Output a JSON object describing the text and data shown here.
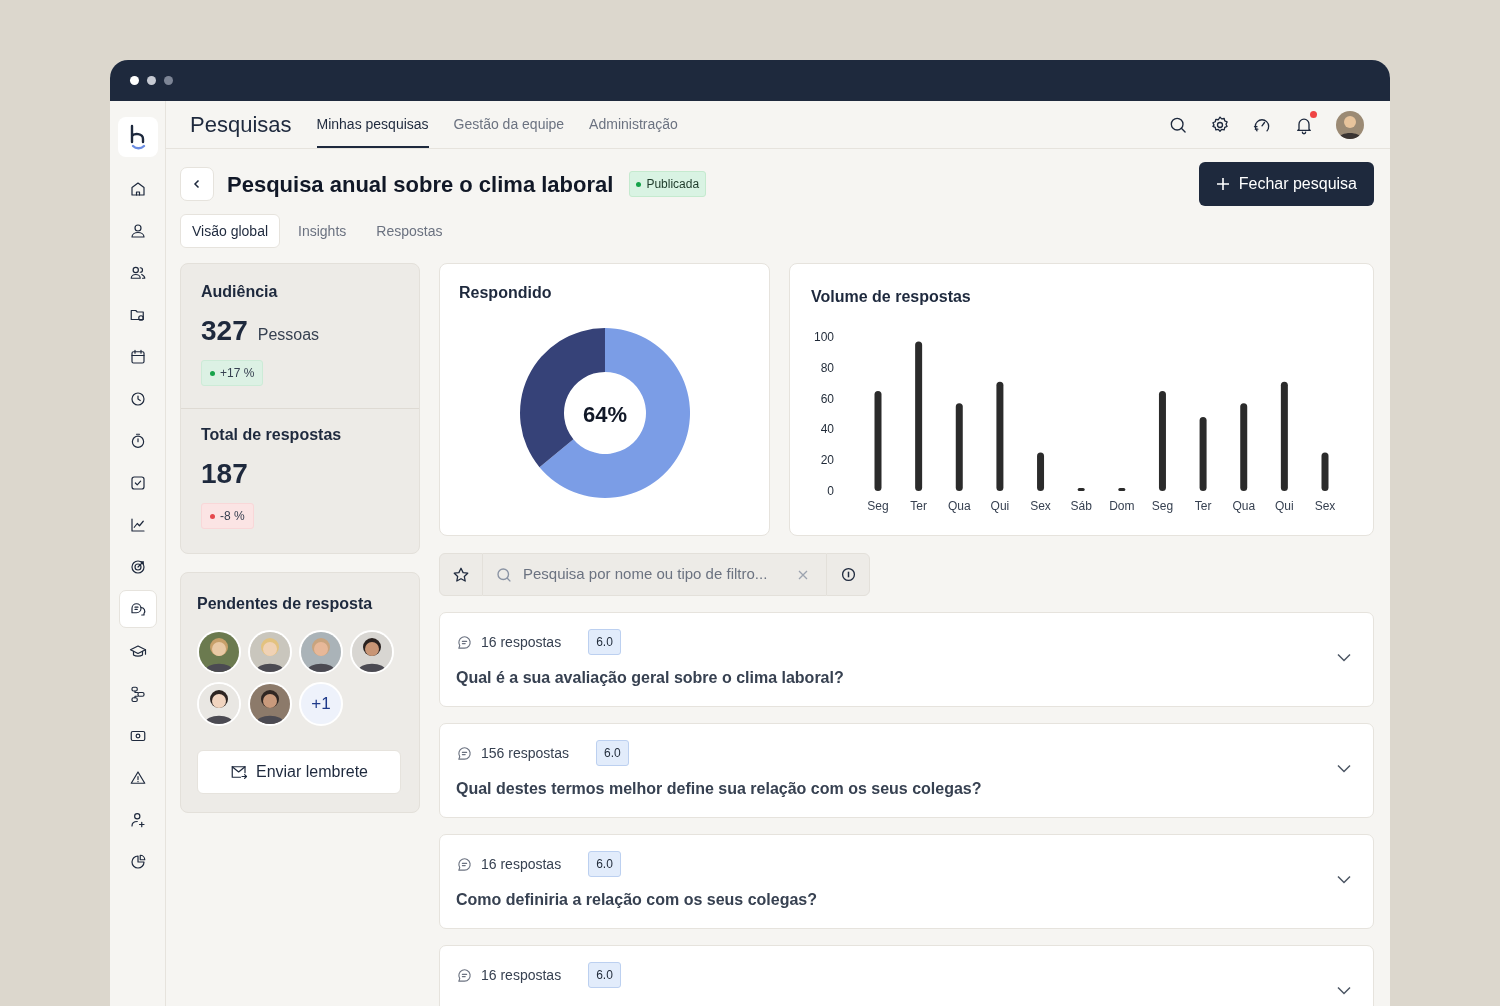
{
  "sidebar": {
    "items": [
      {
        "kind": "home",
        "selected": false
      },
      {
        "kind": "user",
        "selected": false
      },
      {
        "kind": "users",
        "selected": false
      },
      {
        "kind": "folders",
        "selected": false
      },
      {
        "kind": "calendar",
        "selected": false
      },
      {
        "kind": "clock",
        "selected": false
      },
      {
        "kind": "stopwatch",
        "selected": false
      },
      {
        "kind": "check",
        "selected": false
      },
      {
        "kind": "chart",
        "selected": false
      },
      {
        "kind": "target",
        "selected": false
      },
      {
        "kind": "chat",
        "selected": true
      },
      {
        "kind": "cap",
        "selected": false
      },
      {
        "kind": "flow",
        "selected": false
      },
      {
        "kind": "money",
        "selected": false
      },
      {
        "kind": "warning",
        "selected": false
      },
      {
        "kind": "useradd",
        "selected": false
      },
      {
        "kind": "pie",
        "selected": false
      }
    ]
  },
  "header": {
    "title": "Pesquisas",
    "tabs": [
      {
        "label": "Minhas pesquisas",
        "selected": true
      },
      {
        "label": "Gestão da equipe",
        "selected": false
      },
      {
        "label": "Administração",
        "selected": false
      }
    ],
    "unread_notifications": true
  },
  "page": {
    "title": "Pesquisa anual sobre o clima laboral",
    "status": "Publicada",
    "action": "Fechar pesquisa",
    "tabs": [
      {
        "label": "Visão global",
        "selected": true
      },
      {
        "label": "Insights",
        "selected": false
      },
      {
        "label": "Respostas",
        "selected": false
      }
    ]
  },
  "audience": {
    "title": "Audiência",
    "value": "327",
    "unit": "Pessoas",
    "change": "+17 %",
    "color": "#16a34a"
  },
  "responses": {
    "title": "Total de respostas",
    "value": "187",
    "change": "-8 %",
    "color": "#e5484d"
  },
  "responded": {
    "title": "Respondido",
    "label": "64%",
    "chart_data": {
      "type": "donut",
      "values": [
        64,
        36
      ]
    }
  },
  "volume": {
    "title": "Volume de respostas",
    "chart_data": {
      "type": "bar",
      "categories": [
        "Seg",
        "Ter",
        "Qua",
        "Qui",
        "Sex",
        "Sáb",
        "Dom",
        "Seg",
        "Ter",
        "Qua",
        "Qui",
        "Sex"
      ],
      "values": [
        65,
        97,
        57,
        71,
        25,
        2,
        2,
        65,
        48,
        57,
        71,
        25
      ],
      "ylim": [
        0,
        100
      ],
      "yticks": [
        0,
        20,
        40,
        60,
        80,
        100
      ]
    }
  },
  "pending": {
    "title": "Pendentes de resposta",
    "more": "+1",
    "button": "Enviar lembrete"
  },
  "search": {
    "placeholder": "Pesquisa por nome ou tipo de filtro..."
  },
  "questions": [
    {
      "count": "16 respostas",
      "score": "6.0",
      "text": "Qual é a sua avaliação geral sobre o clima laboral?"
    },
    {
      "count": "156 respostas",
      "score": "6.0",
      "text": "Qual destes termos melhor define sua relação com os seus colegas?"
    },
    {
      "count": "16 respostas",
      "score": "6.0",
      "text": "Como definiria a relação com os seus colegas?"
    },
    {
      "count": "16 respostas",
      "score": "6.0"
    }
  ]
}
